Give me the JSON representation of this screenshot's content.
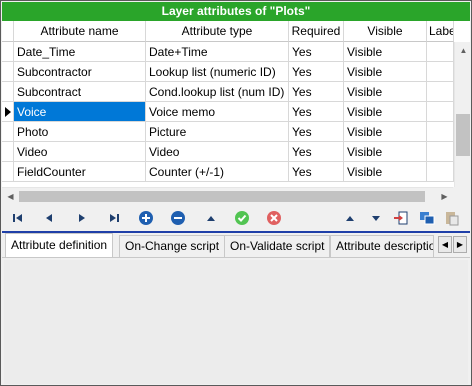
{
  "title": "Layer attributes of \"Plots\"",
  "columns": [
    {
      "label": "Attribute name"
    },
    {
      "label": "Attribute type"
    },
    {
      "label": "Required"
    },
    {
      "label": "Visible"
    },
    {
      "label": "Labe"
    }
  ],
  "rows": [
    {
      "name": "Date_Time",
      "type": "Date+Time",
      "required": "Yes",
      "visible": "Visible"
    },
    {
      "name": "Subcontractor",
      "type": "Lookup list (numeric ID)",
      "required": "Yes",
      "visible": "Visible"
    },
    {
      "name": "Subcontract",
      "type": "Cond.lookup list (num ID)",
      "required": "Yes",
      "visible": "Visible"
    },
    {
      "name": "Voice",
      "type": "Voice memo",
      "required": "Yes",
      "visible": "Visible"
    },
    {
      "name": "Photo",
      "type": "Picture",
      "required": "Yes",
      "visible": "Visible"
    },
    {
      "name": "Video",
      "type": "Video",
      "required": "Yes",
      "visible": "Visible"
    },
    {
      "name": "FieldCounter",
      "type": "Counter (+/-1)",
      "required": "Yes",
      "visible": "Visible"
    }
  ],
  "selected_row": 3,
  "toolbar": {
    "buttons": [
      "first-record-icon",
      "previous-record-icon",
      "next-record-icon",
      "last-record-icon",
      "add-icon",
      "remove-icon",
      "move-up-icon",
      "confirm-icon",
      "cancel-icon",
      "sort-up-icon",
      "sort-down-icon",
      "import-icon",
      "copy-layer-icon",
      "paste-icon"
    ]
  },
  "tabs": [
    {
      "label": "Attribute definition",
      "active": true
    },
    {
      "label": "On-Change script",
      "active": false
    },
    {
      "label": "On-Validate script",
      "active": false
    },
    {
      "label": "Attribute description",
      "active": false
    }
  ],
  "colors": {
    "title_bg": "#2aa52a",
    "selection": "#0078d7",
    "add_remove": "#1f5fb0",
    "confirm": "#52c452",
    "cancel": "#e06060",
    "separator": "#1f3fa8"
  }
}
